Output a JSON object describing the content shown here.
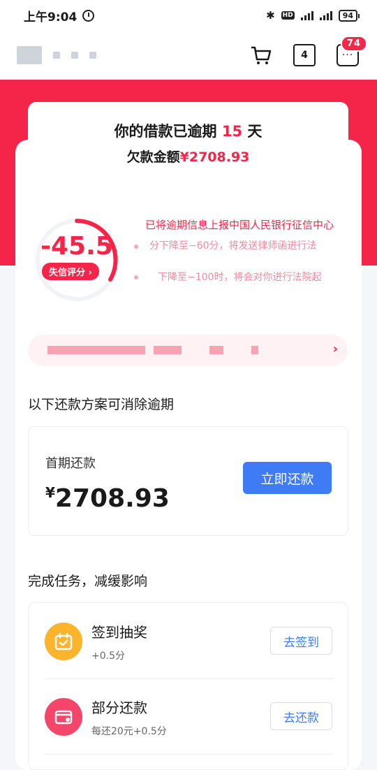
{
  "status_bar": {
    "time": "上午9:04",
    "bt": "✱",
    "hd": "HD",
    "battery": "94"
  },
  "header": {
    "calendar_day": "4",
    "message_dots": "···",
    "message_badge": "74"
  },
  "overdue": {
    "prefix": "你的借款已逾期",
    "days": "15",
    "suffix": "天",
    "amount_label": "欠款金额",
    "amount": "¥2708.93"
  },
  "credit": {
    "score": "-45.5",
    "label": "失信评分 ›",
    "notice_title": "已将逾期信息上报中国人民银行征信中心",
    "notice_line1": "分下降至−60分，将发送律师函进行法",
    "notice_line2": "下降至−100时，将会对你进行法院起"
  },
  "banner": {
    "arrow": "›"
  },
  "repay_section": {
    "title": "以下还款方案可消除逾期",
    "card_label": "首期还款",
    "currency": "¥",
    "amount": "2708.93",
    "button": "立即还款"
  },
  "tasks_section": {
    "title": "完成任务，减缓影响",
    "items": [
      {
        "name": "签到抽奖",
        "sub": "+0.5分",
        "button": "去签到",
        "color": "#fbb42c"
      },
      {
        "name": "部分还款",
        "sub": "每还20元+0.5分",
        "button": "去还款",
        "color": "#f4456a"
      }
    ]
  }
}
